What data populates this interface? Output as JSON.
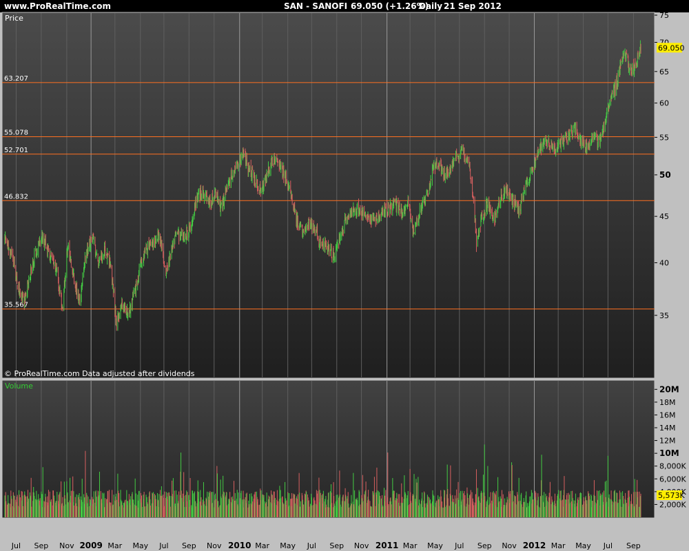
{
  "header": {
    "site": "www.ProRealTime.com",
    "instrument": "SAN - SANOFI",
    "last": "69.050 (+1.26%)",
    "period": "Daily",
    "date": "21 Sep 2012"
  },
  "price_panel": {
    "label": "Price",
    "credit": "© ProRealTime.com  Data adjusted after dividends",
    "last_price_tag": "69.050",
    "horizontal_lines": [
      {
        "label": "63.207",
        "value": 63.207
      },
      {
        "label": "55.078",
        "value": 55.078
      },
      {
        "label": "52.701",
        "value": 52.701
      },
      {
        "label": "46.832",
        "value": 46.832
      },
      {
        "label": "35.567",
        "value": 35.567
      }
    ],
    "y_ticks": [
      {
        "label": "75",
        "value": 75,
        "bold": false
      },
      {
        "label": "70",
        "value": 70,
        "bold": false
      },
      {
        "label": "65",
        "value": 65,
        "bold": false
      },
      {
        "label": "60",
        "value": 60,
        "bold": false
      },
      {
        "label": "55",
        "value": 55,
        "bold": false
      },
      {
        "label": "50",
        "value": 50,
        "bold": true
      },
      {
        "label": "45",
        "value": 45,
        "bold": false
      },
      {
        "label": "40",
        "value": 40,
        "bold": false
      },
      {
        "label": "35",
        "value": 35,
        "bold": false
      }
    ]
  },
  "volume_panel": {
    "label": "Volume",
    "last_volume_tag": "5,573K",
    "y_ticks": [
      {
        "label": "20M",
        "value": 20000000,
        "bold": true
      },
      {
        "label": "18M",
        "value": 18000000,
        "bold": false
      },
      {
        "label": "16M",
        "value": 16000000,
        "bold": false
      },
      {
        "label": "14M",
        "value": 14000000,
        "bold": false
      },
      {
        "label": "12M",
        "value": 12000000,
        "bold": false
      },
      {
        "label": "10M",
        "value": 10000000,
        "bold": true
      },
      {
        "label": "8,000K",
        "value": 8000000,
        "bold": false
      },
      {
        "label": "6,000K",
        "value": 6000000,
        "bold": false
      },
      {
        "label": "4,000K",
        "value": 4000000,
        "bold": false
      },
      {
        "label": "2,000K",
        "value": 2000000,
        "bold": false
      }
    ]
  },
  "x_axis": {
    "start": "2008-06-03",
    "end": "2012-09-21",
    "ticks": [
      {
        "label": "Jul",
        "date": "2008-07-01",
        "bold": false
      },
      {
        "label": "Sep",
        "date": "2008-09-01",
        "bold": false
      },
      {
        "label": "Nov",
        "date": "2008-11-03",
        "bold": false
      },
      {
        "label": "2009",
        "date": "2009-01-02",
        "bold": true
      },
      {
        "label": "Mar",
        "date": "2009-03-02",
        "bold": false
      },
      {
        "label": "May",
        "date": "2009-05-04",
        "bold": false
      },
      {
        "label": "Jul",
        "date": "2009-07-01",
        "bold": false
      },
      {
        "label": "Sep",
        "date": "2009-09-01",
        "bold": false
      },
      {
        "label": "Nov",
        "date": "2009-11-02",
        "bold": false
      },
      {
        "label": "2010",
        "date": "2010-01-04",
        "bold": true
      },
      {
        "label": "Mar",
        "date": "2010-03-01",
        "bold": false
      },
      {
        "label": "May",
        "date": "2010-05-03",
        "bold": false
      },
      {
        "label": "Jul",
        "date": "2010-07-01",
        "bold": false
      },
      {
        "label": "Sep",
        "date": "2010-09-01",
        "bold": false
      },
      {
        "label": "Nov",
        "date": "2010-11-01",
        "bold": false
      },
      {
        "label": "2011",
        "date": "2011-01-03",
        "bold": true
      },
      {
        "label": "Mar",
        "date": "2011-03-01",
        "bold": false
      },
      {
        "label": "May",
        "date": "2011-05-02",
        "bold": false
      },
      {
        "label": "Jul",
        "date": "2011-07-01",
        "bold": false
      },
      {
        "label": "Sep",
        "date": "2011-09-01",
        "bold": false
      },
      {
        "label": "Nov",
        "date": "2011-11-01",
        "bold": false
      },
      {
        "label": "2012",
        "date": "2012-01-02",
        "bold": true
      },
      {
        "label": "Mar",
        "date": "2012-03-01",
        "bold": false
      },
      {
        "label": "May",
        "date": "2012-05-02",
        "bold": false
      },
      {
        "label": "Jul",
        "date": "2012-07-02",
        "bold": false
      },
      {
        "label": "Sep",
        "date": "2012-09-03",
        "bold": false
      }
    ]
  },
  "colors": {
    "up": "#44cc44",
    "down": "#d86060",
    "level_line": "#ff7020",
    "panel_top": "#4a4a4a",
    "panel_bottom": "#222222",
    "last_tag": "#ffee00",
    "frame": "#bfbfbf"
  },
  "chart_data": {
    "type": "line",
    "subtype": "candlestick-with-volume",
    "title": "SAN - SANOFI  69.050 (+1.26%)  Daily  21 Sep 2012",
    "xlabel": "",
    "ylabel": "Price",
    "ylim": [
      30,
      75
    ],
    "volume_ylim": [
      0,
      21000000
    ],
    "series": [
      {
        "name": "Price",
        "points": [
          {
            "date": "2008-06-03",
            "close": 42.5
          },
          {
            "date": "2008-06-20",
            "close": 40.8
          },
          {
            "date": "2008-07-10",
            "close": 37.0
          },
          {
            "date": "2008-07-22",
            "close": 36.3
          },
          {
            "date": "2008-08-05",
            "close": 39.0
          },
          {
            "date": "2008-08-20",
            "close": 41.5
          },
          {
            "date": "2008-09-03",
            "close": 42.8
          },
          {
            "date": "2008-09-20",
            "close": 41.0
          },
          {
            "date": "2008-10-08",
            "close": 39.2
          },
          {
            "date": "2008-10-24",
            "close": 35.5
          },
          {
            "date": "2008-11-05",
            "close": 42.0
          },
          {
            "date": "2008-11-21",
            "close": 38.5
          },
          {
            "date": "2008-12-05",
            "close": 36.0
          },
          {
            "date": "2008-12-20",
            "close": 41.0
          },
          {
            "date": "2009-01-06",
            "close": 42.5
          },
          {
            "date": "2009-01-20",
            "close": 40.0
          },
          {
            "date": "2009-02-05",
            "close": 41.5
          },
          {
            "date": "2009-02-20",
            "close": 39.5
          },
          {
            "date": "2009-03-06",
            "close": 34.2
          },
          {
            "date": "2009-03-20",
            "close": 36.0
          },
          {
            "date": "2009-04-05",
            "close": 35.2
          },
          {
            "date": "2009-04-20",
            "close": 37.0
          },
          {
            "date": "2009-05-05",
            "close": 40.0
          },
          {
            "date": "2009-05-20",
            "close": 41.5
          },
          {
            "date": "2009-06-05",
            "close": 42.0
          },
          {
            "date": "2009-06-20",
            "close": 43.0
          },
          {
            "date": "2009-07-05",
            "close": 39.0
          },
          {
            "date": "2009-07-20",
            "close": 41.5
          },
          {
            "date": "2009-08-05",
            "close": 43.0
          },
          {
            "date": "2009-08-20",
            "close": 42.5
          },
          {
            "date": "2009-09-05",
            "close": 44.0
          },
          {
            "date": "2009-09-20",
            "close": 47.0
          },
          {
            "date": "2009-10-05",
            "close": 48.0
          },
          {
            "date": "2009-10-20",
            "close": 46.5
          },
          {
            "date": "2009-11-05",
            "close": 47.5
          },
          {
            "date": "2009-11-20",
            "close": 46.0
          },
          {
            "date": "2009-12-05",
            "close": 48.5
          },
          {
            "date": "2009-12-20",
            "close": 50.5
          },
          {
            "date": "2010-01-05",
            "close": 51.5
          },
          {
            "date": "2010-01-15",
            "close": 53.0
          },
          {
            "date": "2010-01-25",
            "close": 51.0
          },
          {
            "date": "2010-02-10",
            "close": 49.5
          },
          {
            "date": "2010-02-25",
            "close": 48.0
          },
          {
            "date": "2010-03-10",
            "close": 49.5
          },
          {
            "date": "2010-03-25",
            "close": 52.0
          },
          {
            "date": "2010-04-10",
            "close": 51.5
          },
          {
            "date": "2010-04-25",
            "close": 50.0
          },
          {
            "date": "2010-05-10",
            "close": 47.5
          },
          {
            "date": "2010-05-25",
            "close": 44.5
          },
          {
            "date": "2010-06-10",
            "close": 43.0
          },
          {
            "date": "2010-06-25",
            "close": 44.5
          },
          {
            "date": "2010-07-10",
            "close": 43.5
          },
          {
            "date": "2010-07-25",
            "close": 42.0
          },
          {
            "date": "2010-08-10",
            "close": 41.5
          },
          {
            "date": "2010-08-25",
            "close": 40.8
          },
          {
            "date": "2010-09-10",
            "close": 42.5
          },
          {
            "date": "2010-09-25",
            "close": 45.0
          },
          {
            "date": "2010-10-10",
            "close": 45.5
          },
          {
            "date": "2010-10-25",
            "close": 46.0
          },
          {
            "date": "2010-11-10",
            "close": 45.0
          },
          {
            "date": "2010-11-25",
            "close": 44.5
          },
          {
            "date": "2010-12-10",
            "close": 45.0
          },
          {
            "date": "2010-12-25",
            "close": 45.5
          },
          {
            "date": "2011-01-10",
            "close": 46.0
          },
          {
            "date": "2011-01-25",
            "close": 46.5
          },
          {
            "date": "2011-02-10",
            "close": 45.5
          },
          {
            "date": "2011-02-25",
            "close": 46.5
          },
          {
            "date": "2011-03-10",
            "close": 43.0
          },
          {
            "date": "2011-03-25",
            "close": 45.5
          },
          {
            "date": "2011-04-10",
            "close": 47.0
          },
          {
            "date": "2011-04-25",
            "close": 50.5
          },
          {
            "date": "2011-05-10",
            "close": 51.5
          },
          {
            "date": "2011-05-25",
            "close": 50.0
          },
          {
            "date": "2011-06-10",
            "close": 51.0
          },
          {
            "date": "2011-06-25",
            "close": 52.5
          },
          {
            "date": "2011-07-10",
            "close": 53.0
          },
          {
            "date": "2011-07-25",
            "close": 51.0
          },
          {
            "date": "2011-08-05",
            "close": 47.0
          },
          {
            "date": "2011-08-12",
            "close": 42.0
          },
          {
            "date": "2011-08-25",
            "close": 45.0
          },
          {
            "date": "2011-09-10",
            "close": 46.5
          },
          {
            "date": "2011-09-25",
            "close": 44.5
          },
          {
            "date": "2011-10-10",
            "close": 47.0
          },
          {
            "date": "2011-10-25",
            "close": 48.0
          },
          {
            "date": "2011-11-10",
            "close": 47.0
          },
          {
            "date": "2011-11-25",
            "close": 45.5
          },
          {
            "date": "2011-12-10",
            "close": 48.5
          },
          {
            "date": "2011-12-25",
            "close": 50.5
          },
          {
            "date": "2012-01-10",
            "close": 52.5
          },
          {
            "date": "2012-01-25",
            "close": 54.5
          },
          {
            "date": "2012-02-10",
            "close": 54.0
          },
          {
            "date": "2012-02-25",
            "close": 53.5
          },
          {
            "date": "2012-03-10",
            "close": 54.5
          },
          {
            "date": "2012-03-25",
            "close": 55.0
          },
          {
            "date": "2012-04-10",
            "close": 56.5
          },
          {
            "date": "2012-04-25",
            "close": 55.0
          },
          {
            "date": "2012-05-10",
            "close": 53.5
          },
          {
            "date": "2012-05-25",
            "close": 55.5
          },
          {
            "date": "2012-06-10",
            "close": 54.0
          },
          {
            "date": "2012-06-25",
            "close": 57.5
          },
          {
            "date": "2012-07-10",
            "close": 60.5
          },
          {
            "date": "2012-07-25",
            "close": 63.5
          },
          {
            "date": "2012-08-05",
            "close": 67.0
          },
          {
            "date": "2012-08-15",
            "close": 68.0
          },
          {
            "date": "2012-08-25",
            "close": 65.5
          },
          {
            "date": "2012-09-05",
            "close": 66.0
          },
          {
            "date": "2012-09-15",
            "close": 67.5
          },
          {
            "date": "2012-09-21",
            "close": 69.05
          }
        ]
      }
    ]
  }
}
